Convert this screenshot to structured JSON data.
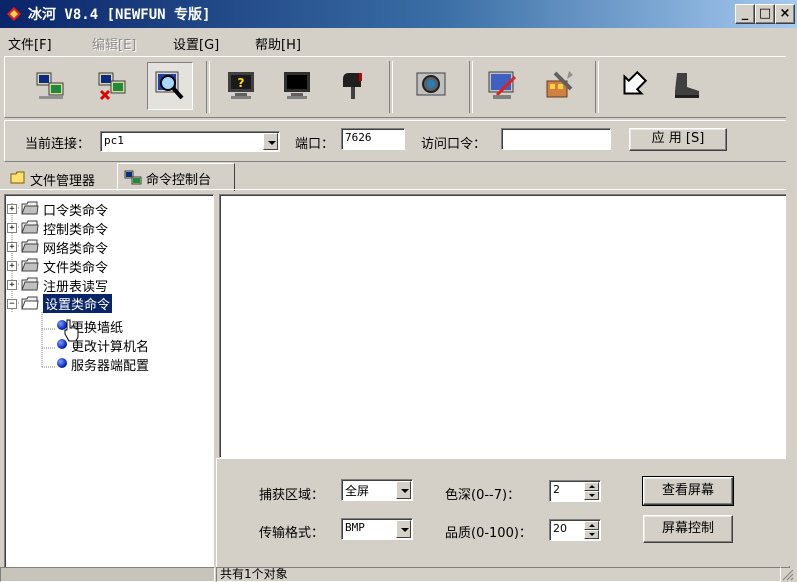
{
  "window": {
    "title": "冰河 V8.4 [NEWFUN 专版]",
    "controls": {
      "minimize": "_",
      "restore": "□",
      "close": "×"
    }
  },
  "menu": [
    {
      "label": "文件[F]",
      "enabled": true
    },
    {
      "label": "编辑[E]",
      "enabled": false
    },
    {
      "label": "设置[G]",
      "enabled": true
    },
    {
      "label": "帮助[H]",
      "enabled": true
    }
  ],
  "toolbar": {
    "buttons": [
      {
        "icon": "add-host-icon"
      },
      {
        "icon": "delete-host-icon"
      },
      {
        "icon": "search-host-icon",
        "active": true
      },
      {
        "icon": "help-monitor-icon"
      },
      {
        "icon": "screen-monitor-icon"
      },
      {
        "icon": "mailbox-icon"
      },
      {
        "icon": "camera-icon"
      },
      {
        "icon": "screen-edit-icon"
      },
      {
        "icon": "tools-icon"
      },
      {
        "icon": "exit-arrow-icon"
      },
      {
        "icon": "boot-icon"
      }
    ]
  },
  "connection": {
    "current_label": "当前连接：",
    "current_value": "pc1",
    "port_label": "端口：",
    "port_value": "7626",
    "password_label": "访问口令：",
    "password_value": "",
    "apply_label": "应 用 [S]"
  },
  "tabs": [
    {
      "label": "文件管理器",
      "active": false
    },
    {
      "label": "命令控制台",
      "active": true
    }
  ],
  "tree": {
    "nodes": [
      {
        "label": "口令类命令",
        "expanded": false
      },
      {
        "label": "控制类命令",
        "expanded": false
      },
      {
        "label": "网络类命令",
        "expanded": false
      },
      {
        "label": "文件类命令",
        "expanded": false
      },
      {
        "label": "注册表读写",
        "expanded": false
      },
      {
        "label": "设置类命令",
        "expanded": true,
        "selected": true
      }
    ],
    "children": [
      {
        "label": "更换墙纸"
      },
      {
        "label": "更改计算机名"
      },
      {
        "label": "服务器端配置"
      }
    ]
  },
  "control_panel": {
    "capture_area_label": "捕获区域：",
    "capture_area_value": "全屏",
    "format_label": "传输格式：",
    "format_value": "BMP",
    "color_depth_label": "色深(0--7)：",
    "color_depth_value": "2",
    "quality_label": "品质(0-100)：",
    "quality_value": "20",
    "view_screen_label": "查看屏幕",
    "screen_control_label": "屏幕控制"
  },
  "status": {
    "text": "共有1个对象"
  }
}
